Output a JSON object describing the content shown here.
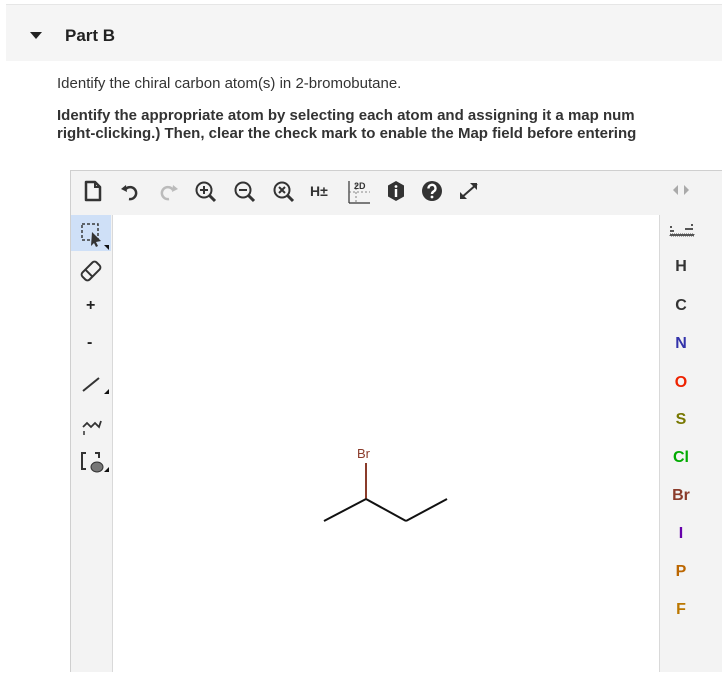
{
  "section": {
    "title": "Part B"
  },
  "question": "Identify the chiral carbon atom(s) in 2-bromobutane.",
  "instructions": [
    "Identify the appropriate atom by selecting each atom and assigning it a map num",
    "right-clicking.) Then, clear the check mark to enable the Map field before entering"
  ],
  "toolbar": {
    "icons": [
      "new-document-icon",
      "undo-icon",
      "redo-icon",
      "zoom-in-icon",
      "zoom-out-icon",
      "zoom-reset-icon",
      "hydrogen-toggle-label",
      "clean-2d-icon",
      "info-icon",
      "help-icon",
      "fullscreen-icon"
    ],
    "hydrogen_label": "H±",
    "clean_label": "2D"
  },
  "left_tools": {
    "plus_label": "+",
    "minus_label": "-"
  },
  "periodic_button_label": "",
  "elements": [
    {
      "symbol": "H",
      "color": "#333333"
    },
    {
      "symbol": "C",
      "color": "#333333"
    },
    {
      "symbol": "N",
      "color": "#3333aa"
    },
    {
      "symbol": "O",
      "color": "#ee2200"
    },
    {
      "symbol": "S",
      "color": "#777700"
    },
    {
      "symbol": "Cl",
      "color": "#00aa00"
    },
    {
      "symbol": "Br",
      "color": "#8a3b2a"
    },
    {
      "symbol": "I",
      "color": "#6600aa"
    },
    {
      "symbol": "P",
      "color": "#bb6600"
    },
    {
      "symbol": "F",
      "color": "#bb7700"
    }
  ],
  "molecule": {
    "substituent_label": "Br"
  }
}
